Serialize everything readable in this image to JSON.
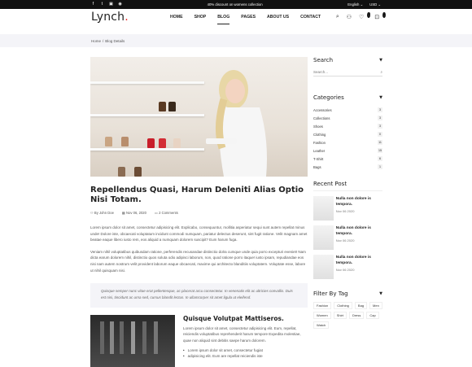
{
  "topbar": {
    "promo": "40% discount on womens collection",
    "language": "English ⌄",
    "currency": "USD ⌄"
  },
  "header": {
    "logo": "Lynch",
    "nav": [
      "HOME",
      "SHOP",
      "BLOG",
      "PAGES",
      "ABOUT US",
      "CONTACT"
    ],
    "wishlist_count": "0",
    "cart_count": "0"
  },
  "breadcrumb": {
    "home": "Home",
    "current": "Blog Details"
  },
  "post": {
    "title": "Repellendus Quasi, Harum Deleniti Alias Optio Nisi Totam.",
    "author": "By John Doe",
    "date": "Nov 06, 2020",
    "comments": "2 Comments",
    "para1": "Lorem ipsum dolor sit amet, consectetur adipisicing elit. Explicabo, consequuntur, mollitia asperiatur sequi sunt autem repellat minus unde! Dolore iste, obcaecati voluptatum incidunt commodi numquam, pariatur delectus deserunt, sint fugit ratione. Velit magnam amet beatae eaque libero iusto rem, eos aliquid a numquam dolorem suscipit? Eum harum fuga.",
    "para2": "Veniam nihil voluptatibus quibusdam ratione, perferendis recusandae distinctio dolra cumque unde quia porro excepturi eveniet! Nam dicta earum dolorem nihil, distinctio quos soluta odio adipisci laborum, non, quod ratione porro itaque! iusto ipsam, repudiandae eos nisi nam autem nostrum velit provident laborum eaque obcaecati, maxime qui architecto blanditiis voluptatem. Voluptate esse, labore ut nihil quisquam nisi.",
    "quote": "Quisque semper nunc vitae erat pellentesque, ac placerat arcu consectetur. In venenatis elit ac ultricies convallis. Duis est nisi, tincidunt ac urna sed, cursus blandit lectus. In ullamcorper sit amet ligula ut eleifend.",
    "subtitle": "Quisque Volutpat Mattiseros.",
    "subtext": "Lorem ipsum dolor sit amet, consectetur adipisicing elit. Eum, repellat, reiciendis voluptatibus reprehenderit harum tempore Expedita molestiae, quae non aliquid sint debitis saepe harum dolorem.",
    "bullets": [
      "Lorem ipsum dolor sit amet, consectetur fugiat",
      "adipisicing elit. Eum are repellat reiciendis iste"
    ]
  },
  "sidebar": {
    "search_title": "Search",
    "search_placeholder": "Search...",
    "categories_title": "Categories",
    "categories": [
      {
        "name": "Accessories",
        "count": "3"
      },
      {
        "name": "Collections",
        "count": "3"
      },
      {
        "name": "Shoes",
        "count": "3"
      },
      {
        "name": "Clothing",
        "count": "0"
      },
      {
        "name": "Fashion",
        "count": "11"
      },
      {
        "name": "Leather",
        "count": "15"
      },
      {
        "name": "T-Shirt",
        "count": "6"
      },
      {
        "name": "Bags",
        "count": "1"
      }
    ],
    "recent_title": "Recent Post",
    "recent": [
      {
        "title": "Nulla non dolore is tempora.",
        "date": "Nov 06 2020"
      },
      {
        "title": "Nulla non dolore is tempora.",
        "date": "Nov 06 2020"
      },
      {
        "title": "Nulla non dolore is tempora.",
        "date": "Nov 06 2020"
      }
    ],
    "tags_title": "Filter By Tag",
    "tags": [
      "Fashion",
      "Clothing",
      "Bag",
      "Men",
      "Women",
      "Shirt",
      "Dress",
      "Cap",
      "Watch"
    ]
  },
  "colors": {
    "accent": "#e22222",
    "topbar": "#111111"
  }
}
